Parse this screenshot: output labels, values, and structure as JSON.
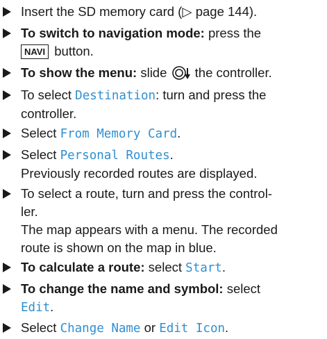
{
  "items": [
    {
      "pre": "Insert the SD memory card (",
      "tri": "▷",
      "post": " page 144)."
    },
    {
      "bold": "To switch to navigation mode:",
      "text": " press the",
      "key": "NAVI",
      "post": " button."
    },
    {
      "bold": "To show the menu:",
      "pre": " slide ",
      "post": " the controller."
    },
    {
      "pre": "To select ",
      "disp": "Destination",
      "post": ": turn and press the",
      "line2": "controller."
    },
    {
      "pre": "Select ",
      "disp": "From Memory Card",
      "post": "."
    },
    {
      "pre": "Select ",
      "disp": "Personal Routes",
      "post": ".",
      "note": "Previously recorded routes are displayed."
    },
    {
      "line1": "To select a route, turn and press the control-",
      "line2": "ler.",
      "note1": "The map appears with a menu. The recorded",
      "note2": "route is shown on the map in blue."
    },
    {
      "bold": "To calculate a route:",
      "pre": " select ",
      "disp": "Start",
      "post": "."
    },
    {
      "bold": "To change the name and symbol:",
      "pre": " select",
      "disp": "Edit",
      "post": "."
    },
    {
      "pre": "Select ",
      "disp1": "Change Name",
      "mid": " or ",
      "disp2": "Edit Icon",
      "post": "."
    }
  ]
}
